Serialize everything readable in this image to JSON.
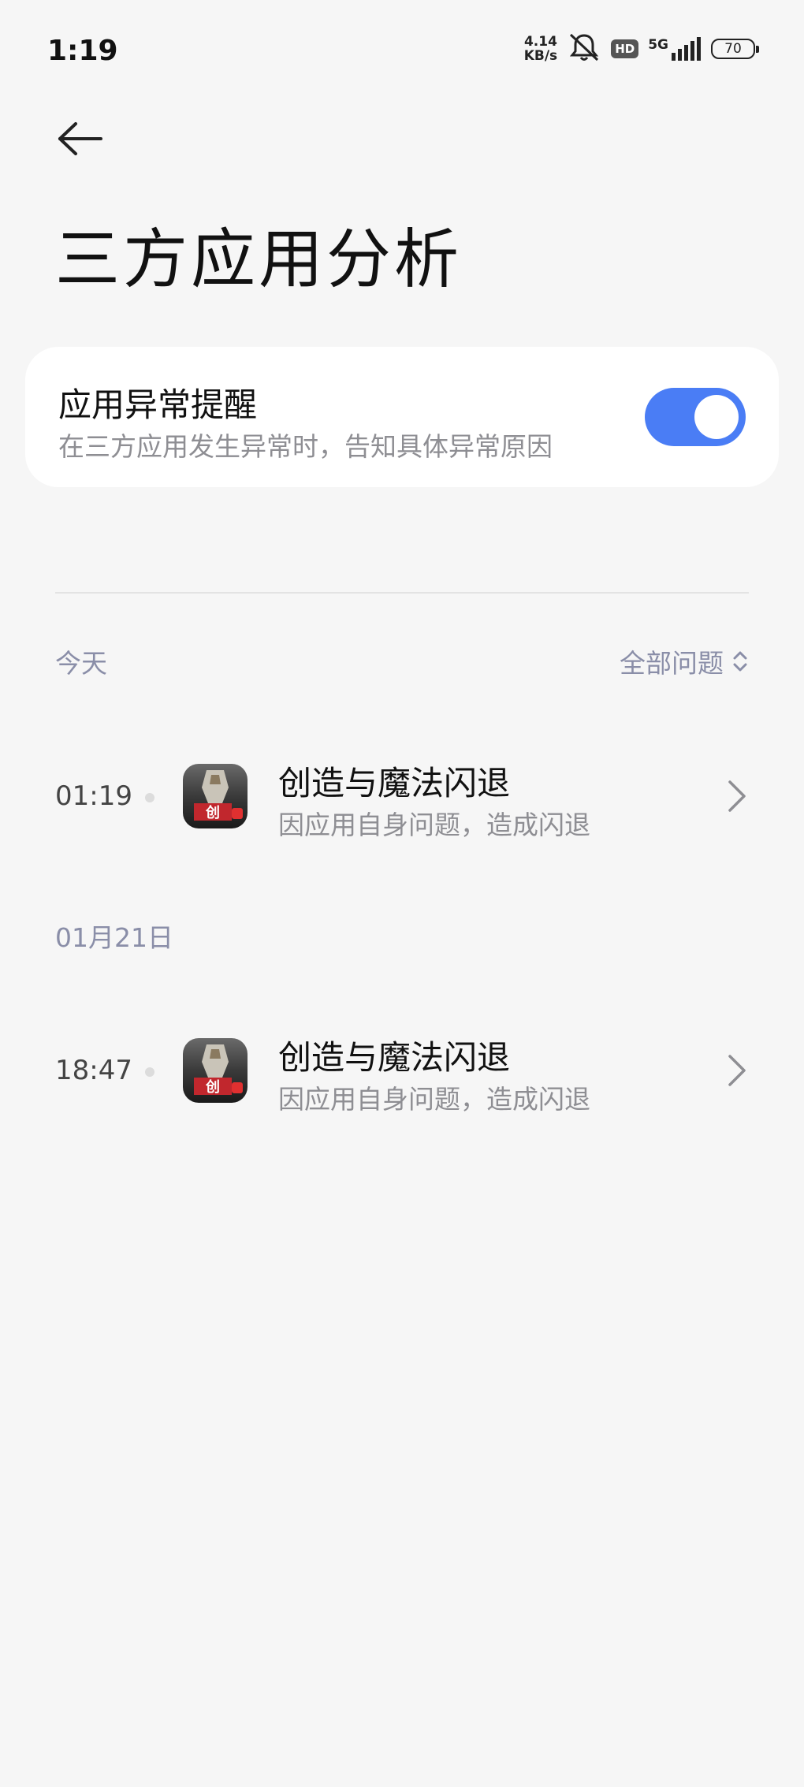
{
  "status_bar": {
    "time": "1:19",
    "net_speed_value": "4.14",
    "net_speed_unit": "KB/s",
    "hd_label": "HD",
    "network_label": "5G",
    "battery_level": "70",
    "icons": [
      "mute-bell-icon",
      "signal-icon",
      "battery-icon"
    ]
  },
  "header": {
    "back_icon": "arrow-left-icon",
    "title": "三方应用分析"
  },
  "alert_setting": {
    "title": "应用异常提醒",
    "subtitle": "在三方应用发生异常时，告知具体异常原因",
    "enabled": true,
    "toggle_color": "#4a7df5"
  },
  "filter": {
    "label": "全部问题",
    "icon": "up-down-chevron-icon"
  },
  "groups": [
    {
      "date_label": "今天",
      "events": [
        {
          "time": "01:19",
          "app_name": "创造与魔法闪退",
          "reason": "因应用自身问题，造成闪退"
        }
      ]
    },
    {
      "date_label": "01月21日",
      "events": [
        {
          "time": "18:47",
          "app_name": "创造与魔法闪退",
          "reason": "因应用自身问题，造成闪退"
        }
      ]
    }
  ]
}
